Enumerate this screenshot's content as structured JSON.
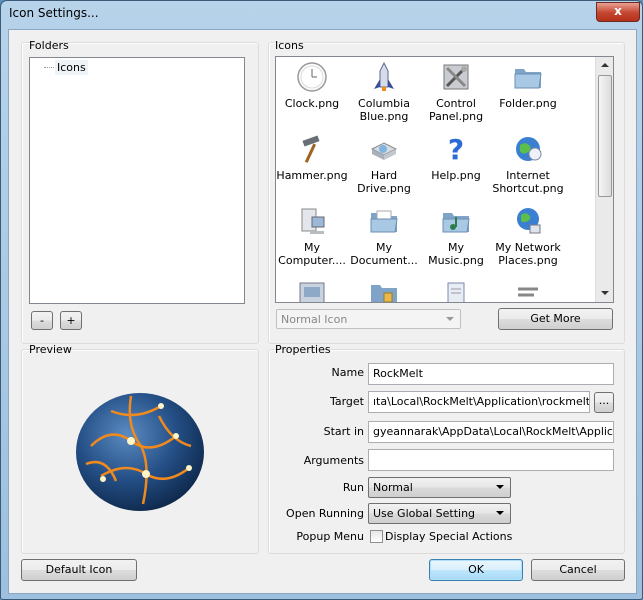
{
  "window": {
    "title": "Icon Settings...",
    "close_glyph": "x"
  },
  "folders": {
    "label": "Folders",
    "tree": [
      {
        "label": "Icons"
      }
    ],
    "remove_label": "-",
    "add_label": "+"
  },
  "icons": {
    "label": "Icons",
    "items": [
      {
        "label": "Clock.png",
        "icon": "clock-icon"
      },
      {
        "label": "Columbia Blue.png",
        "icon": "shuttle-icon"
      },
      {
        "label": "Control Panel.png",
        "icon": "control-panel-icon"
      },
      {
        "label": "Folder.png",
        "icon": "folder-icon"
      },
      {
        "label": "Hammer.png",
        "icon": "hammer-icon"
      },
      {
        "label": "Hard Drive.png",
        "icon": "hard-drive-icon"
      },
      {
        "label": "Help.png",
        "icon": "help-icon"
      },
      {
        "label": "Internet Shortcut.png",
        "icon": "globe-icon"
      },
      {
        "label": "My Computer....",
        "icon": "computer-icon"
      },
      {
        "label": "My Document...",
        "icon": "documents-folder-icon"
      },
      {
        "label": "My Music.png",
        "icon": "music-folder-icon"
      },
      {
        "label": "My Network Places.png",
        "icon": "network-icon"
      }
    ],
    "style_select": "Normal Icon",
    "get_more_label": "Get More"
  },
  "preview": {
    "label": "Preview",
    "icon": "rockmelt-globe-icon"
  },
  "properties": {
    "label": "Properties",
    "name_label": "Name",
    "name_value": "RockMelt",
    "target_label": "Target",
    "target_value": "ıta\\Local\\RockMelt\\Application\\rockmelt.exe",
    "browse_label": "...",
    "startin_label": "Start in",
    "startin_value": "gyeannarak\\AppData\\Local\\RockMelt\\Application",
    "arguments_label": "Arguments",
    "arguments_value": "",
    "run_label": "Run",
    "run_value": "Normal",
    "open_running_label": "Open Running",
    "open_running_value": "Use Global Setting",
    "popup_menu_label": "Popup Menu",
    "popup_menu_checkbox_label": "Display Special Actions",
    "popup_menu_checked": false
  },
  "footer": {
    "default_icon_label": "Default Icon",
    "ok_label": "OK",
    "cancel_label": "Cancel"
  }
}
